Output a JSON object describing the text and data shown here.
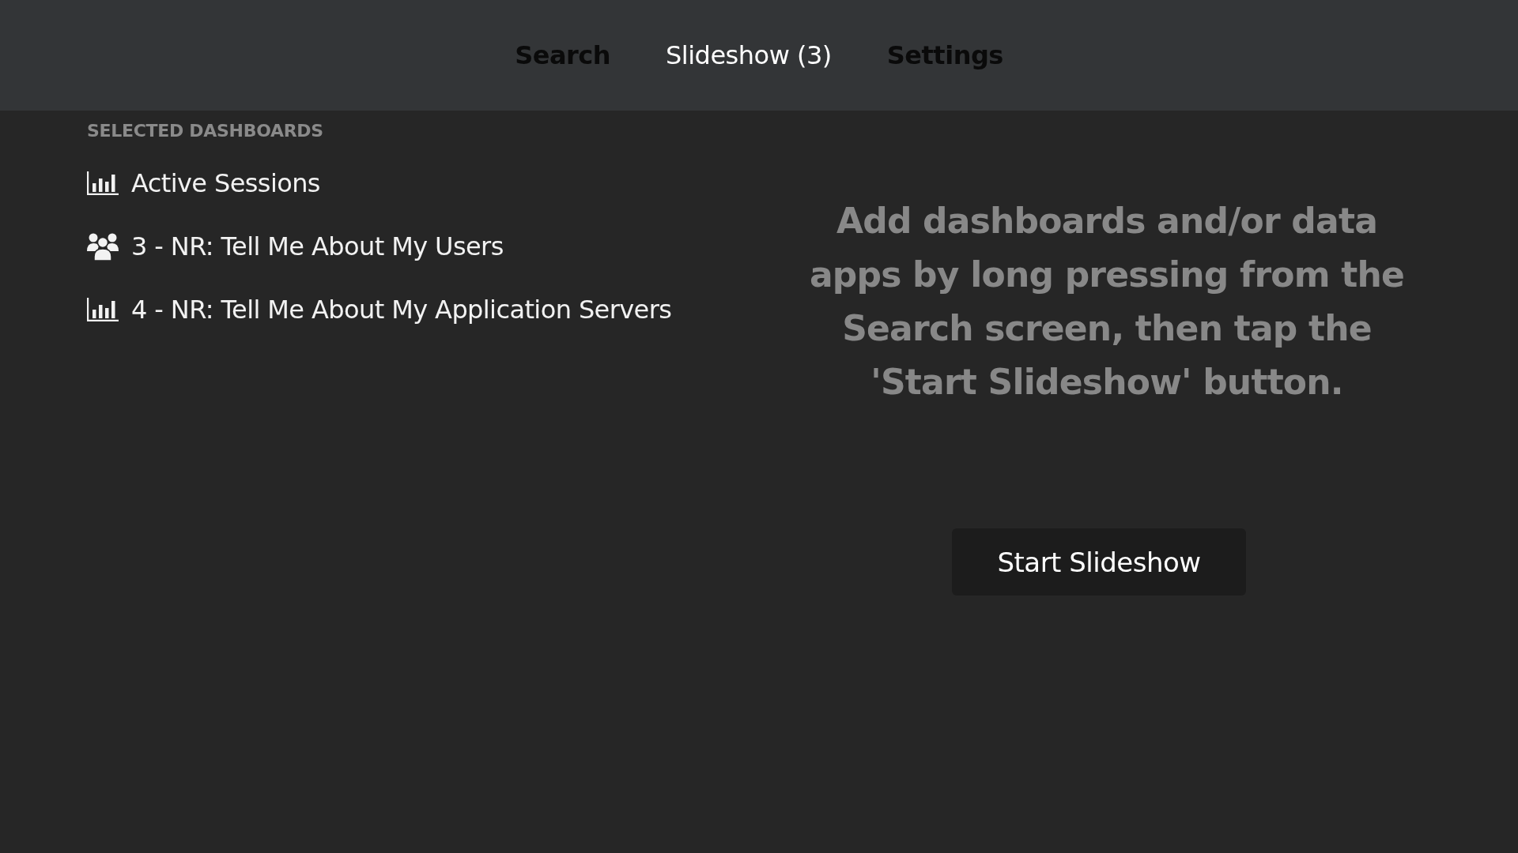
{
  "tabs": [
    {
      "label": "Search",
      "selected": false
    },
    {
      "label": "Slideshow (3)",
      "selected": true
    },
    {
      "label": "Settings",
      "selected": false
    }
  ],
  "selected_dashboards": {
    "heading": "SELECTED DASHBOARDS",
    "items": [
      {
        "label": "Active Sessions",
        "kind": "chart"
      },
      {
        "label": "3 - NR: Tell Me About My Users",
        "kind": "people"
      },
      {
        "label": "4 - NR: Tell Me About My Application Servers",
        "kind": "chart"
      }
    ]
  },
  "hint": "Add dashboards and/or data apps by long pressing from the Search screen, then tap the 'Start Slideshow' button.",
  "start_button": "Start Slideshow"
}
